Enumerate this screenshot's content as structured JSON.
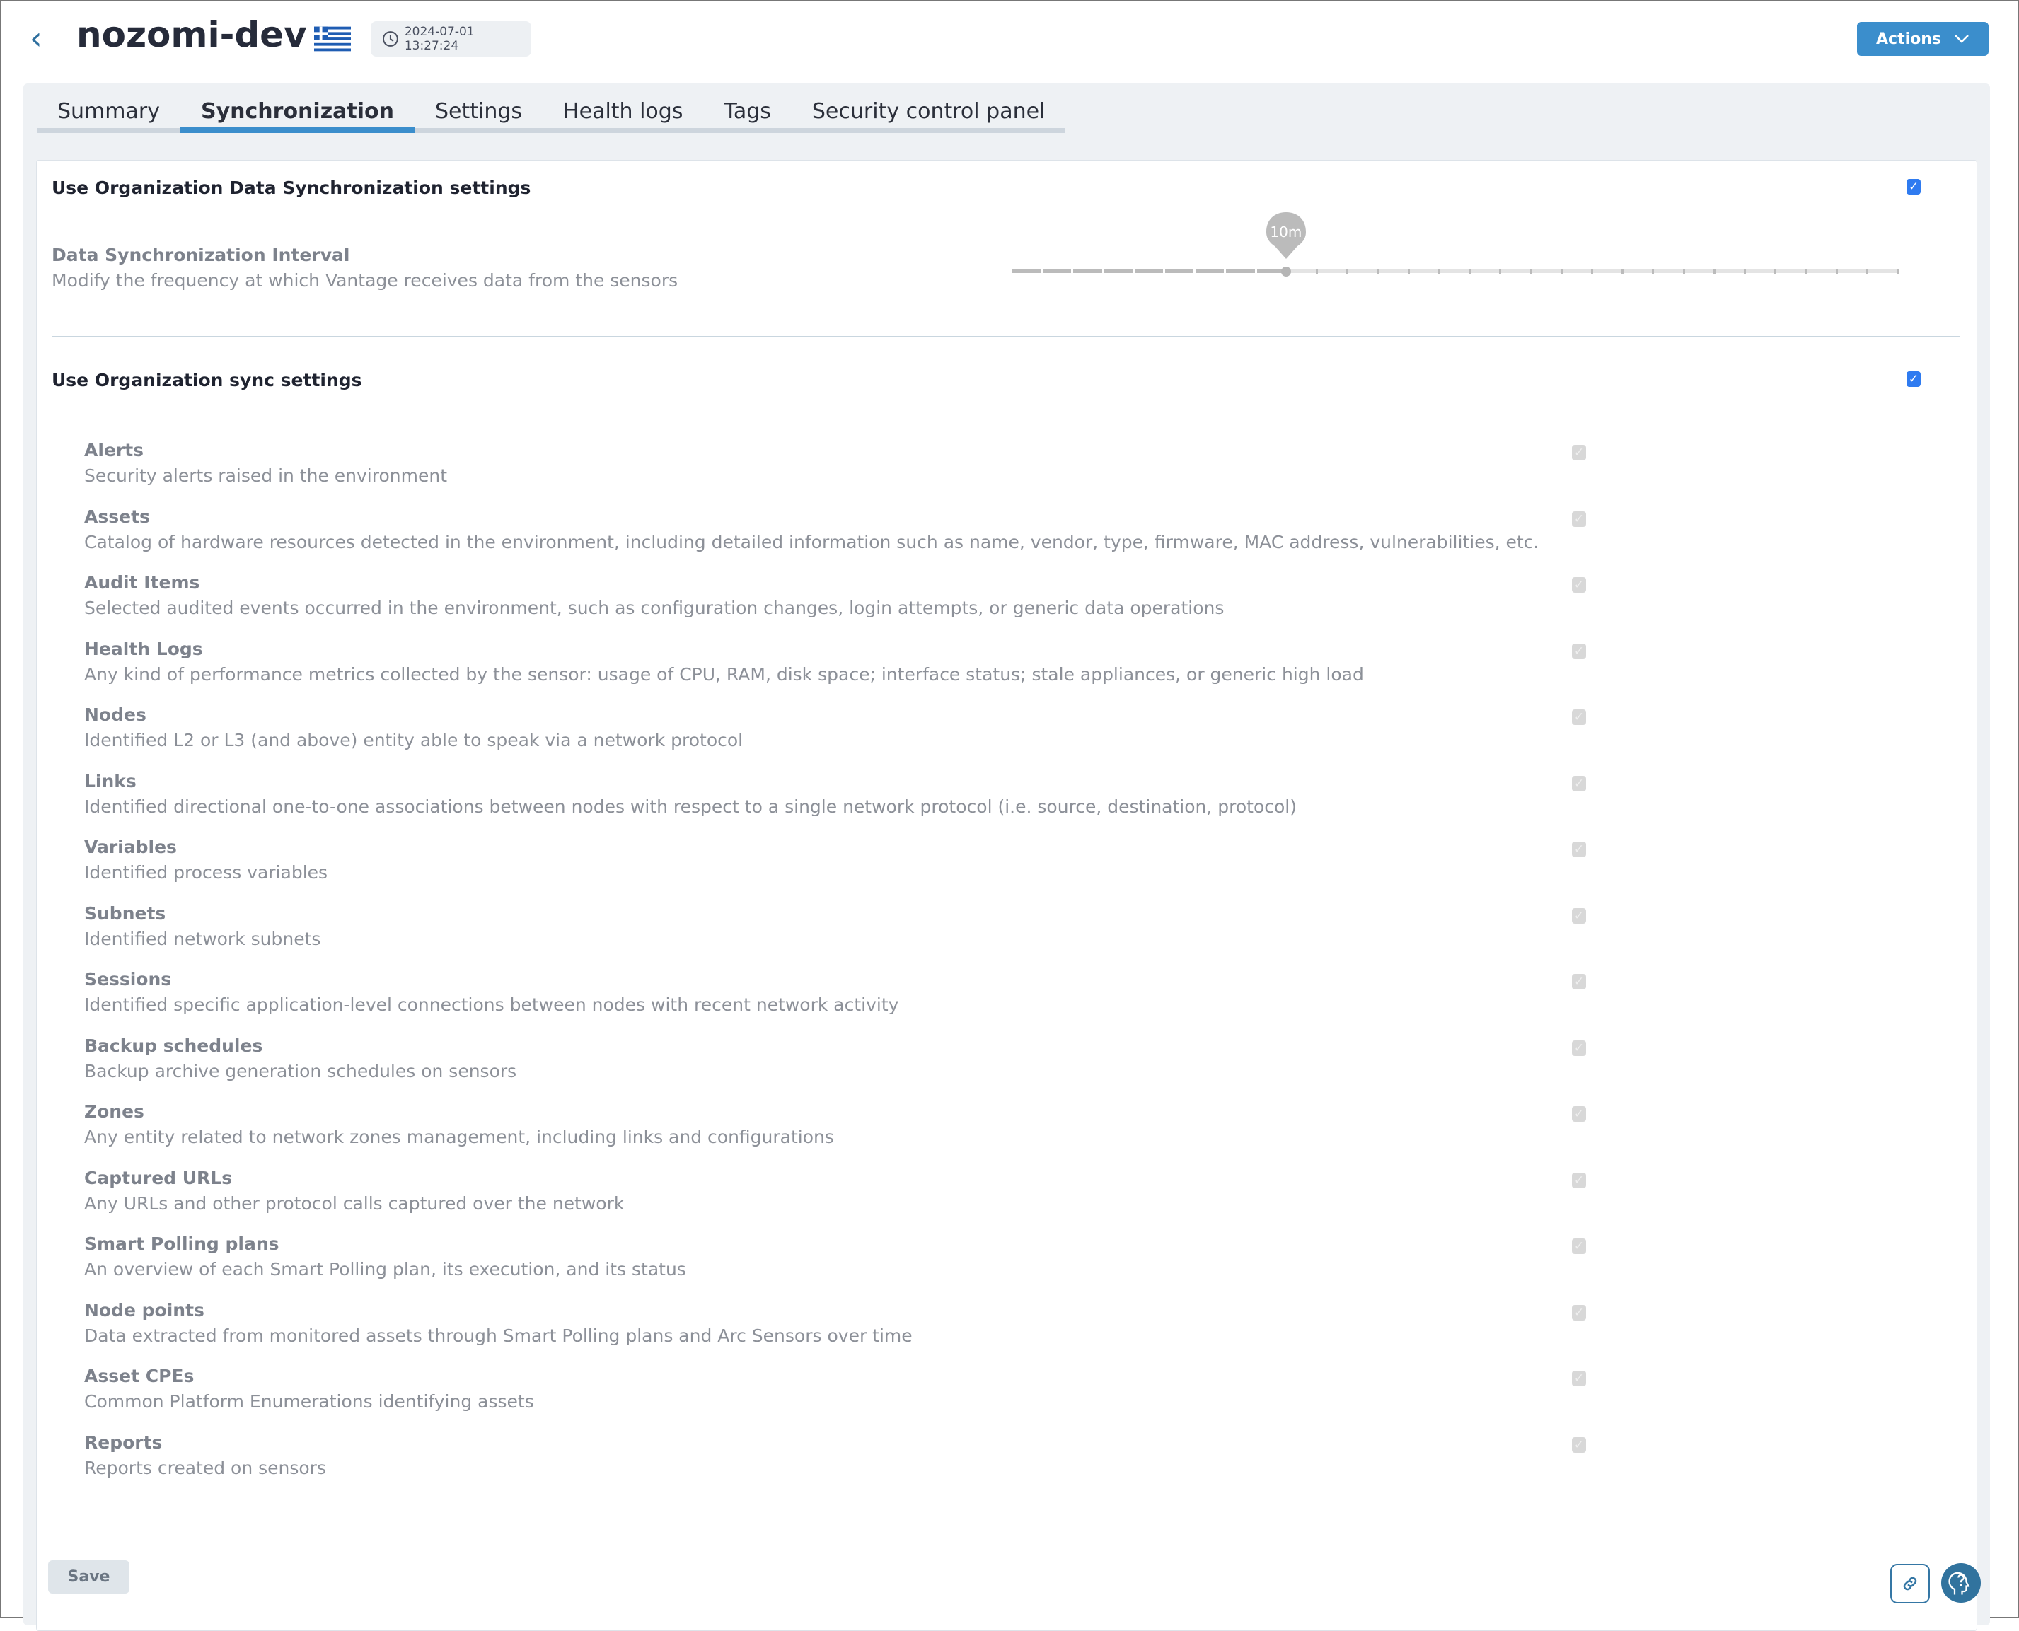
{
  "header": {
    "title": "nozomi-dev",
    "flag": "greece-flag",
    "timestamp": "2024-07-01 13:27:24",
    "actions_label": "Actions"
  },
  "tabs": [
    {
      "label": "Summary"
    },
    {
      "label": "Synchronization",
      "active": true
    },
    {
      "label": "Settings"
    },
    {
      "label": "Health logs"
    },
    {
      "label": "Tags"
    },
    {
      "label": "Security control panel"
    }
  ],
  "data_sync": {
    "title": "Use Organization Data Synchronization settings",
    "checked": true,
    "interval_label": "Data Synchronization Interval",
    "interval_desc": "Modify the frequency at which Vantage receives data from the sensors",
    "slider_value": "10m",
    "slider_fraction": 0.31
  },
  "sync": {
    "title": "Use Organization sync settings",
    "checked": true,
    "items": [
      {
        "label": "Alerts",
        "desc": "Security alerts raised in the environment"
      },
      {
        "label": "Assets",
        "desc": "Catalog of hardware resources detected in the environment, including detailed information such as name, vendor, type, firmware, MAC address, vulnerabilities, etc."
      },
      {
        "label": "Audit Items",
        "desc": "Selected audited events occurred in the environment, such as configuration changes, login attempts, or generic data operations"
      },
      {
        "label": "Health Logs",
        "desc": "Any kind of performance metrics collected by the sensor: usage of CPU, RAM, disk space; interface status; stale appliances, or generic high load"
      },
      {
        "label": "Nodes",
        "desc": "Identified L2 or L3 (and above) entity able to speak via a network protocol"
      },
      {
        "label": "Links",
        "desc": "Identified directional one-to-one associations between nodes with respect to a single network protocol (i.e. source, destination, protocol)"
      },
      {
        "label": "Variables",
        "desc": "Identified process variables"
      },
      {
        "label": "Subnets",
        "desc": "Identified network subnets"
      },
      {
        "label": "Sessions",
        "desc": "Identified specific application-level connections between nodes with recent network activity"
      },
      {
        "label": "Backup schedules",
        "desc": "Backup archive generation schedules on sensors"
      },
      {
        "label": "Zones",
        "desc": "Any entity related to network zones management, including links and configurations"
      },
      {
        "label": "Captured URLs",
        "desc": "Any URLs and other protocol calls captured over the network"
      },
      {
        "label": "Smart Polling plans",
        "desc": "An overview of each Smart Polling plan, its execution, and its status"
      },
      {
        "label": "Node points",
        "desc": "Data extracted from monitored assets through Smart Polling plans and Arc Sensors over time"
      },
      {
        "label": "Asset CPEs",
        "desc": "Common Platform Enumerations identifying assets"
      },
      {
        "label": "Reports",
        "desc": "Reports created on sensors"
      }
    ]
  },
  "footer": {
    "save_label": "Save",
    "link_icon": "link-icon",
    "help_icon": "help-head-icon"
  },
  "colors": {
    "accent": "#3b8ecc",
    "checkbox": "#2f7bf0",
    "help": "#31739e"
  }
}
